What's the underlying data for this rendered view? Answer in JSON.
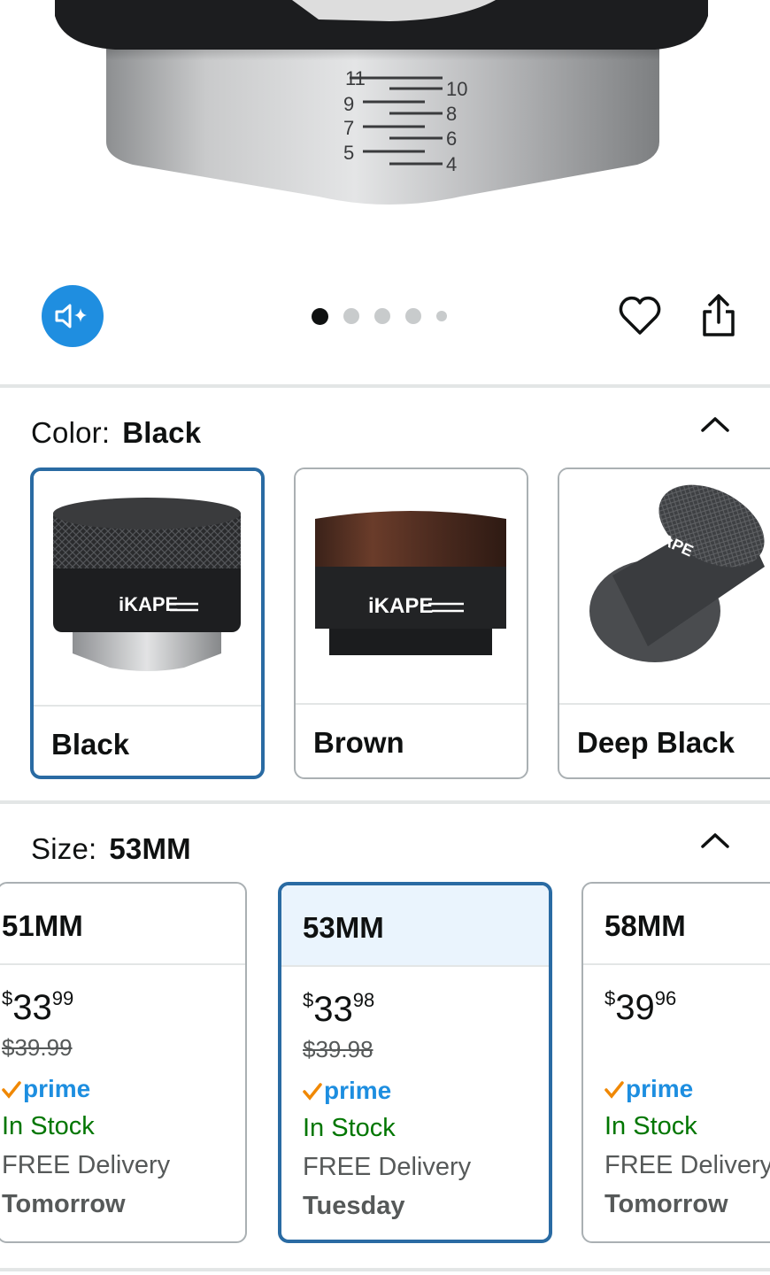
{
  "hero": {
    "scale_labels_left": [
      "11",
      "9",
      "7",
      "5"
    ],
    "scale_labels_right": [
      "10",
      "8",
      "6",
      "4"
    ]
  },
  "controls": {
    "audio_icon": "speaker-sparkle-icon",
    "carousel_total": 5,
    "carousel_active": 1,
    "heart_icon": "heart-icon",
    "share_icon": "share-icon"
  },
  "color": {
    "label": "Color:",
    "value": "Black",
    "options": [
      {
        "name": "Black",
        "selected": true,
        "brand": "iKAPE"
      },
      {
        "name": "Brown",
        "selected": false,
        "brand": "iKAPE"
      },
      {
        "name": "Deep Black",
        "selected": false,
        "brand": "iKAPE"
      }
    ]
  },
  "size": {
    "label": "Size:",
    "value": "53MM",
    "options": [
      {
        "name": "51MM",
        "currency": "$",
        "whole": "33",
        "fraction": "99",
        "was": "$39.99",
        "prime": "prime",
        "stock": "In Stock",
        "delivery": "FREE Delivery",
        "when": "Tomorrow",
        "selected": false
      },
      {
        "name": "53MM",
        "currency": "$",
        "whole": "33",
        "fraction": "98",
        "was": "$39.98",
        "prime": "prime",
        "stock": "In Stock",
        "delivery": "FREE Delivery",
        "when": "Tuesday",
        "selected": true
      },
      {
        "name": "58MM",
        "currency": "$",
        "whole": "39",
        "fraction": "96",
        "was": "",
        "prime": "prime",
        "stock": "In Stock",
        "delivery": "FREE Delivery",
        "when": "Tomorrow",
        "selected": false
      }
    ]
  },
  "colors": {
    "accent_blue": "#2a6ba3",
    "prime_blue": "#1d8ee0",
    "in_stock_green": "#007600",
    "prime_check_orange": "#f08804",
    "audio_button_blue": "#1f8ee0"
  }
}
